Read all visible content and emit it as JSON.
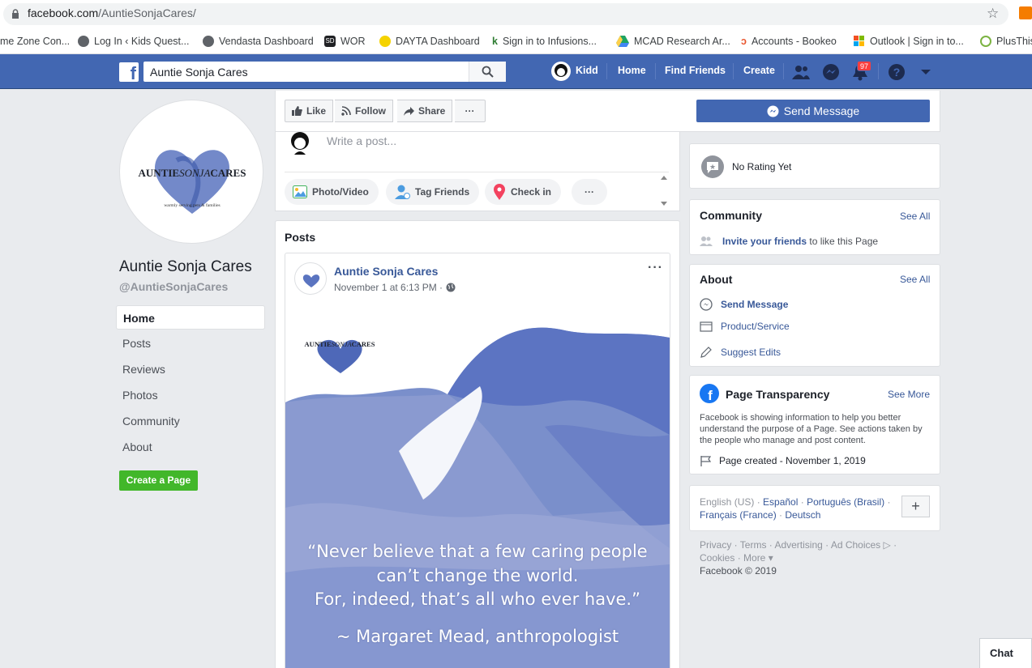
{
  "browser": {
    "url_domain": "facebook.com",
    "url_path": "/AuntieSonjaCares/",
    "bookmarks": [
      {
        "label": "me Zone Con...",
        "icon": "none",
        "color": "#ffffff"
      },
      {
        "label": "Log In ‹ Kids Quest...",
        "icon": "globe-icon",
        "color": "#5f6368"
      },
      {
        "label": "Vendasta Dashboard",
        "icon": "globe-icon",
        "color": "#5f6368"
      },
      {
        "label": "WOR",
        "icon": "sd-icon",
        "color": "#202124"
      },
      {
        "label": "DAYTA Dashboard",
        "icon": "yellow-dot-icon",
        "color": "#f5d300"
      },
      {
        "label": "Sign in to Infusions...",
        "icon": "k-icon",
        "color": "#2e7d32"
      },
      {
        "label": "MCAD Research Ar...",
        "icon": "drive-icon",
        "color": "#1fa463"
      },
      {
        "label": "Accounts - Bookeo",
        "icon": "bookeo-icon",
        "color": "#e8532b"
      },
      {
        "label": "Outlook | Sign in to...",
        "icon": "windows-icon",
        "color": "#f25022"
      },
      {
        "label": "PlusThis",
        "icon": "plusthis-icon",
        "color": "#7cb342"
      }
    ]
  },
  "header": {
    "search_value": "Auntie Sonja Cares",
    "user_name": "Kidd",
    "nav": [
      "Home",
      "Find Friends",
      "Create"
    ],
    "notification_count": "97"
  },
  "sidebar": {
    "logo_text_main": "AUNTIE",
    "logo_text_mid": "SONJA",
    "logo_text_end": "CARES",
    "logo_tagline": "warmly serving pets & families",
    "page_name": "Auntie Sonja Cares",
    "page_handle": "@AuntieSonjaCares",
    "items": [
      "Home",
      "Posts",
      "Reviews",
      "Photos",
      "Community",
      "About"
    ],
    "create_page": "Create a Page"
  },
  "actions": {
    "like": "Like",
    "follow": "Follow",
    "share": "Share",
    "more": "···",
    "send_message": "Send Message"
  },
  "composer": {
    "placeholder": "Write a post...",
    "photo_video": "Photo/Video",
    "tag_friends": "Tag Friends",
    "check_in": "Check in",
    "more": "···"
  },
  "posts": {
    "title": "Posts",
    "author": "Auntie Sonja Cares",
    "time": "November 1 at 6:13 PM ·",
    "more": "···",
    "quote_line1": "“Never believe that a few caring people",
    "quote_line2": "can’t change the world.",
    "quote_line3": "For, indeed, that’s all who ever have.”",
    "quote_attribution": "~ Margaret Mead, anthropologist"
  },
  "right": {
    "rating": "No Rating Yet",
    "community_title": "Community",
    "see_all": "See All",
    "invite_link": "Invite your friends",
    "invite_rest": " to like this Page",
    "about_title": "About",
    "about_send": "Send Message",
    "about_product": "Product/Service",
    "about_suggest": "Suggest Edits",
    "transparency_title": "Page Transparency",
    "see_more": "See More",
    "transparency_text": "Facebook is showing information to help you better understand the purpose of a Page. See actions taken by the people who manage and post content.",
    "page_created": "Page created - November 1, 2019",
    "lang_current": "English (US) · ",
    "lang_es": "Español",
    "lang_sep1": " · ",
    "lang_pt": "Português (Brasil)",
    "lang_sep2": " · ",
    "lang_fr": "Français (France)",
    "lang_sep3": " · ",
    "lang_de": "Deutsch",
    "lang_plus": "+",
    "legal_line1": "Privacy · Terms · Advertising · Ad Choices ▷ ·",
    "legal_line2": "Cookies · More ▾",
    "legal_line3": "Facebook © 2019"
  },
  "chat": "Chat"
}
